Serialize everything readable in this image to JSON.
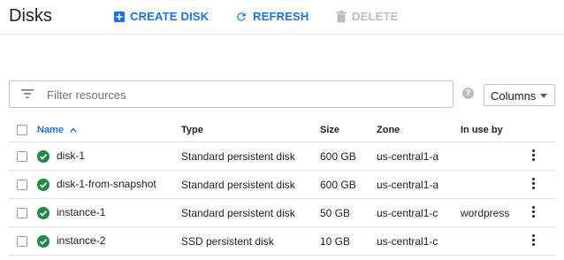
{
  "header": {
    "title": "Disks",
    "create_label": "CREATE DISK",
    "refresh_label": "REFRESH",
    "delete_label": "DELETE"
  },
  "filter": {
    "placeholder": "Filter resources",
    "columns_label": "Columns"
  },
  "table": {
    "headers": {
      "name": "Name",
      "type": "Type",
      "size": "Size",
      "zone": "Zone",
      "in_use_by": "In use by"
    },
    "rows": [
      {
        "name": "disk-1",
        "type": "Standard persistent disk",
        "size": "600 GB",
        "zone": "us-central1-a",
        "in_use_by": ""
      },
      {
        "name": "disk-1-from-snapshot",
        "type": "Standard persistent disk",
        "size": "600 GB",
        "zone": "us-central1-a",
        "in_use_by": ""
      },
      {
        "name": "instance-1",
        "type": "Standard persistent disk",
        "size": "50 GB",
        "zone": "us-central1-c",
        "in_use_by": "wordpress"
      },
      {
        "name": "instance-2",
        "type": "SSD persistent disk",
        "size": "10 GB",
        "zone": "us-central1-c",
        "in_use_by": ""
      }
    ]
  },
  "colors": {
    "accent": "#1a73e8",
    "status_ok": "#1e8e3e",
    "disabled": "#bdbdbd"
  },
  "icons": {
    "create": "add-box-icon",
    "refresh": "refresh-icon",
    "delete": "trash-icon",
    "filter": "filter-icon",
    "status": "check-circle-icon",
    "sort": "arrow-up-icon",
    "row_menu": "more-vert-icon"
  }
}
